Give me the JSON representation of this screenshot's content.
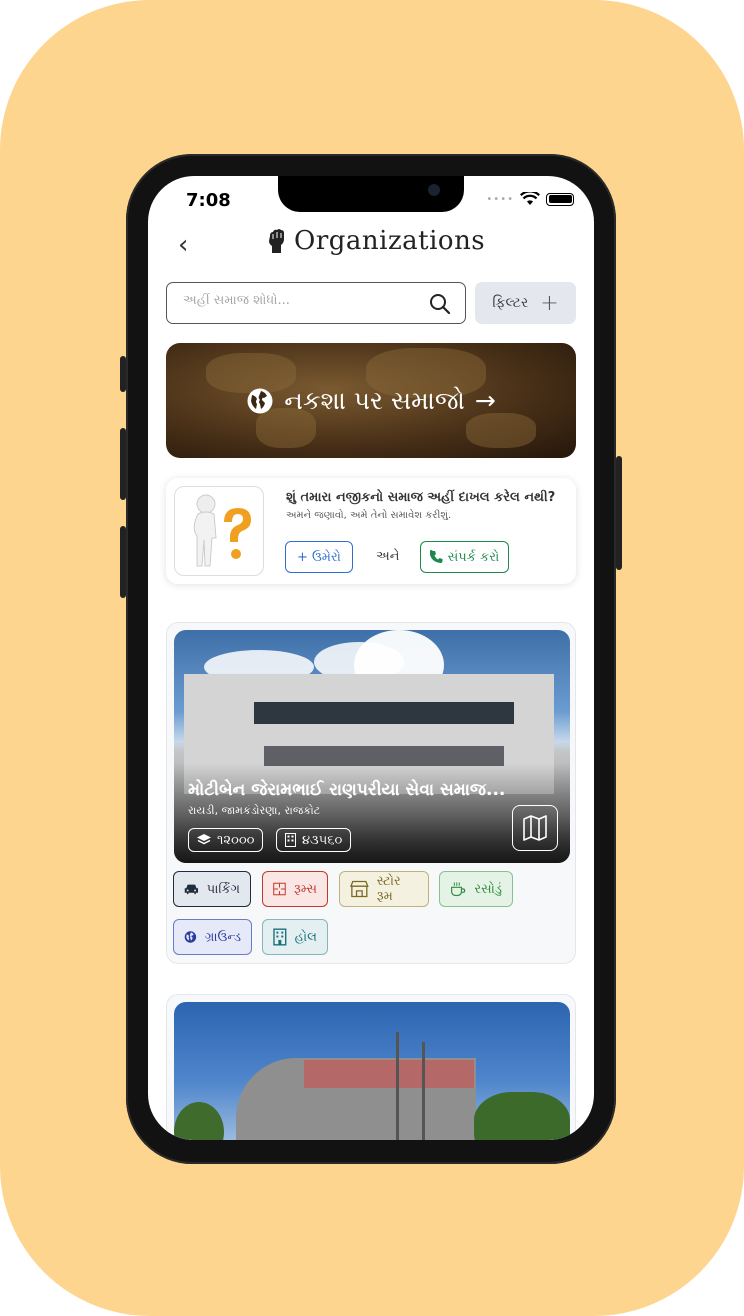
{
  "status_bar": {
    "time": "7:08"
  },
  "header": {
    "title": "Organizations",
    "back_icon": "chevron-left-icon",
    "title_icon": "raised-fist-icon"
  },
  "search": {
    "placeholder": "અહીં સમાજ શોધો...",
    "value": ""
  },
  "filter": {
    "label": "ફિલ્ટર",
    "plus": "+"
  },
  "map_banner": {
    "label": "નકશા પર સમાજો",
    "arrow": "→"
  },
  "prompt_card": {
    "question": "શું તમારા નજીકનો સમાજ અહીં દાખલ કરેલ નથી?",
    "subtitle": "અમને જણાવો, અમે તેનો સમાવેશ કરીશું.",
    "add_label": "ઉમેરો",
    "add_plus": "+",
    "and_label": "અને",
    "contact_label": "સંપર્ક કરો"
  },
  "organizations": [
    {
      "name": "મોટીબેન જેરામભાઈ રાણપરીયા સેવા સમાજ...",
      "address": "રાયડી, જામકંડોરણા, રાજકોટ",
      "stat_area": "૧૨૦૦૦",
      "stat_built": "૪૩૫૬૦",
      "amenities": [
        {
          "label": "પાર્કિંગ",
          "icon": "car-icon",
          "color": "#1f2d3d"
        },
        {
          "label": "રૂમ્સ",
          "icon": "rooms-icon",
          "color": "#c0392b"
        },
        {
          "label": "સ્ટોર રૂમ",
          "icon": "store-icon",
          "color": "#7a6a20"
        },
        {
          "label": "રસોડું",
          "icon": "cup-icon",
          "color": "#2e8b3a"
        },
        {
          "label": "ગ્રાઉન્ડ",
          "icon": "globe-icon",
          "color": "#2a3c9c"
        },
        {
          "label": "હોલ",
          "icon": "building-icon",
          "color": "#1a6f7a"
        }
      ]
    }
  ],
  "colors": {
    "background": "#FDD58F",
    "primary_blue": "#2f6fd0",
    "contact_green": "#1b8a4b"
  }
}
